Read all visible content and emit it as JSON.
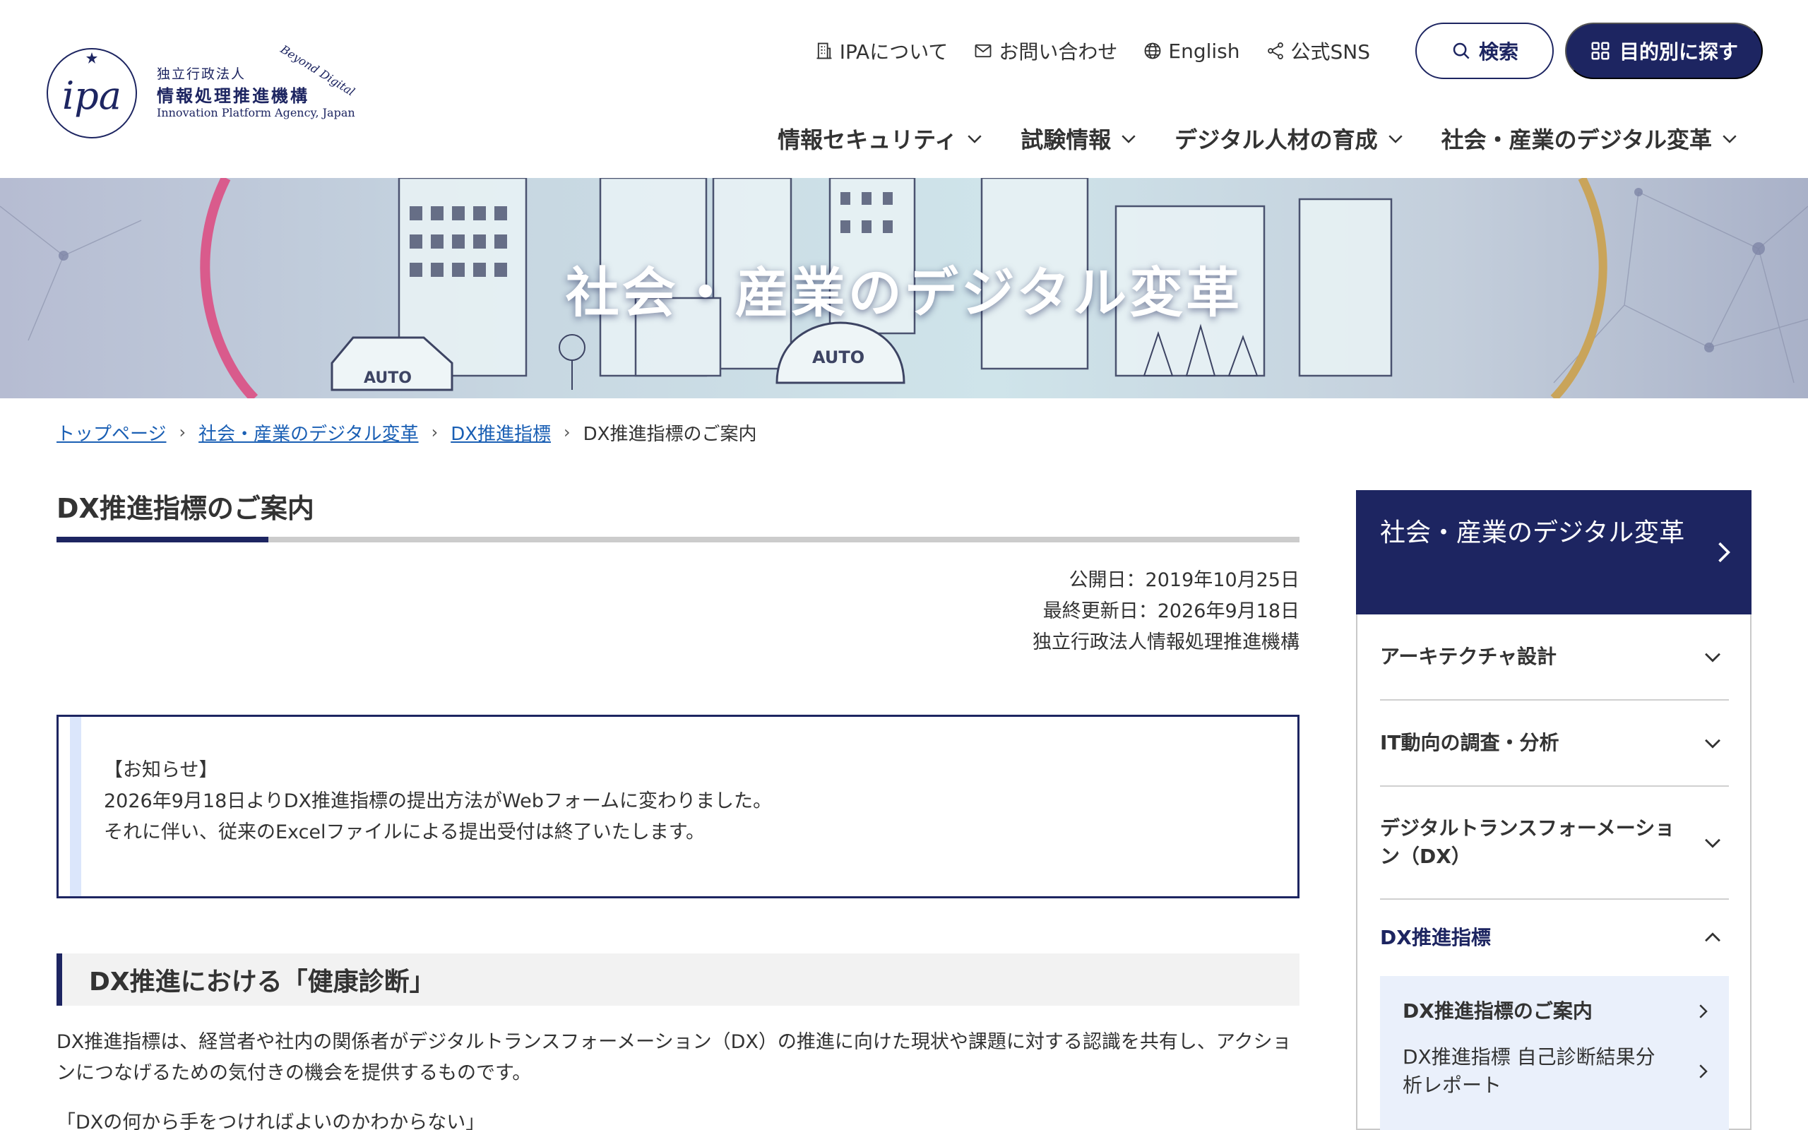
{
  "logo": {
    "beyond": "Beyond Digital",
    "org_line1": "独立行政法人",
    "org_line2": "情報処理推進機構",
    "org_en": "Innovation Platform Agency, Japan"
  },
  "util_nav": [
    {
      "label": "IPAについて",
      "icon": "building-icon"
    },
    {
      "label": "お問い合わせ",
      "icon": "mail-icon"
    },
    {
      "label": "English",
      "icon": "globe-icon"
    },
    {
      "label": "公式SNS",
      "icon": "share-icon"
    }
  ],
  "header_buttons": {
    "search": "検索",
    "purpose": "目的別に探す"
  },
  "main_nav": [
    {
      "label": "情報セキュリティ"
    },
    {
      "label": "試験情報"
    },
    {
      "label": "デジタル人材の育成"
    },
    {
      "label": "社会・産業のデジタル変革"
    }
  ],
  "hero": {
    "title": "社会・産業のデジタル変革"
  },
  "breadcrumb": [
    {
      "label": "トップページ",
      "link": true
    },
    {
      "label": "社会・産業のデジタル変革",
      "link": true
    },
    {
      "label": "DX推進指標",
      "link": true
    },
    {
      "label": "DX推進指標のご案内",
      "link": false
    }
  ],
  "page": {
    "title": "DX推進指標のご案内",
    "published": "公開日：2019年10月25日",
    "updated": "最終更新日：2026年9月18日",
    "publisher": "独立行政法人情報処理推進機構"
  },
  "notice": {
    "heading": "【お知らせ】",
    "line1": "2026年9月18日よりDX推進指標の提出方法がWebフォームに変わりました。",
    "line2": "それに伴い、従来のExcelファイルによる提出受付は終了いたします。"
  },
  "section": {
    "heading": "DX推進における「健康診断」",
    "para1": "DX推進指標は、経営者や社内の関係者がデジタルトランスフォーメーション（DX）の推進に向けた現状や課題に対する認識を共有し、アクションにつなげるための気付きの機会を提供するものです。",
    "para2": "「DXの何から手をつければよいのかわからない」"
  },
  "sidebar": {
    "head": "社会・産業のデジタル変革",
    "items": [
      {
        "label": "アーキテクチャ設計",
        "expanded": false
      },
      {
        "label": "IT動向の調査・分析",
        "expanded": false
      },
      {
        "label": "デジタルトランスフォーメーション（DX）",
        "expanded": false
      },
      {
        "label": "DX推進指標",
        "expanded": true
      }
    ],
    "sub_items": [
      {
        "label": "DX推進指標のご案内",
        "current": true
      },
      {
        "label": "DX推進指標 自己診断結果分析レポート",
        "current": false
      }
    ]
  },
  "colors": {
    "brand_navy": "#1d2561",
    "link_blue": "#1a5fb4",
    "notice_bar": "#dbe6fb",
    "sub_bg": "#eaf0fb"
  }
}
